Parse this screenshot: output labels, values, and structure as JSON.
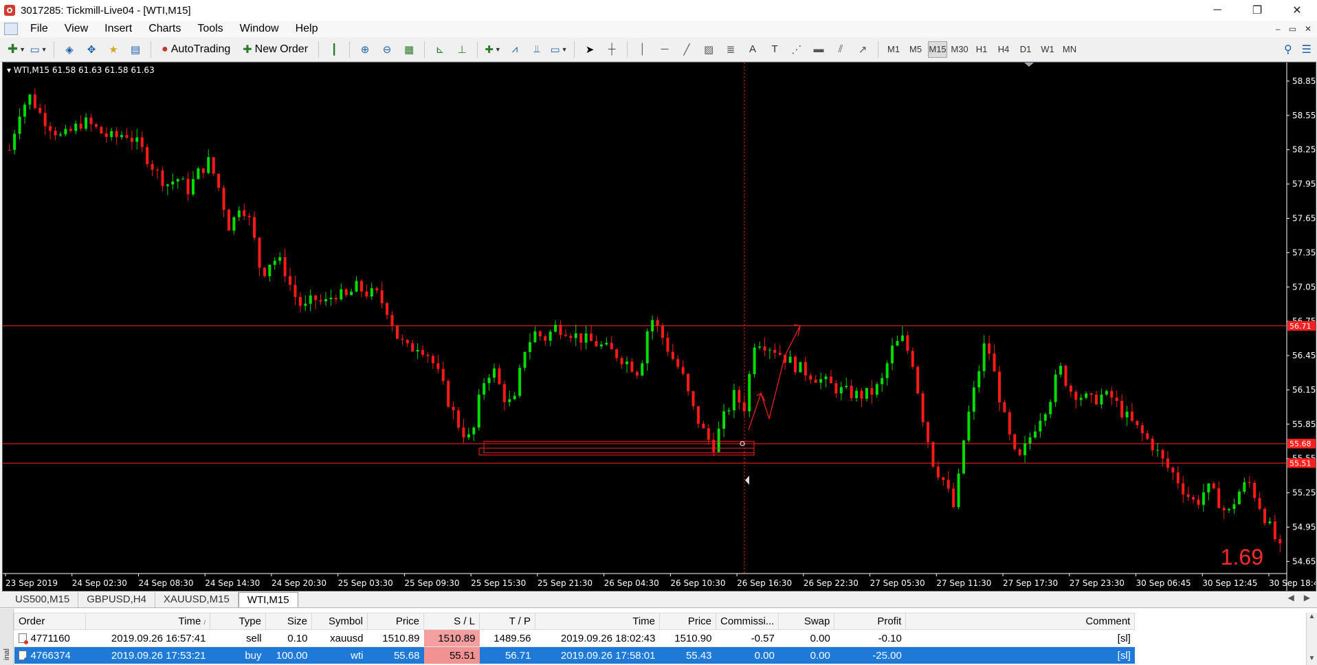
{
  "window": {
    "title": "3017285: Tickmill-Live04 - [WTI,M15]",
    "minimize": "─",
    "maximize": "❐",
    "close": "✕"
  },
  "menu": {
    "items": [
      "File",
      "View",
      "Insert",
      "Charts",
      "Tools",
      "Window",
      "Help"
    ],
    "mdi_min": "–",
    "mdi_restore": "▭",
    "mdi_close": "✕"
  },
  "toolbar": {
    "autotrading_label": "AutoTrading",
    "new_order_label": "New Order",
    "timeframes": [
      "M1",
      "M5",
      "M15",
      "M30",
      "H1",
      "H4",
      "D1",
      "W1",
      "MN"
    ],
    "active_timeframe": "M15"
  },
  "chart": {
    "info": "WTI,M15  61.58 61.63 61.58 61.63",
    "big_number": "1.69"
  },
  "chart_data": {
    "type": "candlestick",
    "symbol": "WTI",
    "timeframe": "M15",
    "y_ticks": [
      58.85,
      58.55,
      58.25,
      57.95,
      57.65,
      57.35,
      57.05,
      56.75,
      56.45,
      56.15,
      55.85,
      55.55,
      55.25,
      54.95,
      54.65
    ],
    "ylim": [
      54.55,
      59.0
    ],
    "x_labels": [
      "23 Sep 2019",
      "24 Sep 02:30",
      "24 Sep 08:30",
      "24 Sep 14:30",
      "24 Sep 20:30",
      "25 Sep 03:30",
      "25 Sep 09:30",
      "25 Sep 15:30",
      "25 Sep 21:30",
      "26 Sep 04:30",
      "26 Sep 10:30",
      "26 Sep 16:30",
      "26 Sep 22:30",
      "27 Sep 05:30",
      "27 Sep 11:30",
      "27 Sep 17:30",
      "27 Sep 23:30",
      "30 Sep 06:45",
      "30 Sep 12:45",
      "30 Sep 18:45"
    ],
    "price_lines": [
      {
        "value": 56.71,
        "label": "56.71"
      },
      {
        "value": 55.68,
        "label": "55.68"
      },
      {
        "value": 55.51,
        "label": "55.51"
      }
    ],
    "close_path": [
      58.25,
      58.6,
      58.72,
      58.55,
      58.45,
      58.35,
      58.42,
      58.5,
      58.45,
      58.38,
      58.35,
      58.4,
      58.32,
      58.2,
      58.05,
      57.95,
      58.0,
      57.9,
      58.05,
      58.15,
      57.9,
      57.55,
      57.8,
      57.6,
      57.15,
      57.3,
      57.25,
      57.0,
      56.85,
      56.95,
      56.9,
      57.0,
      56.95,
      57.05,
      57.0,
      56.98,
      56.85,
      56.6,
      56.5,
      56.55,
      56.45,
      56.25,
      56.0,
      55.8,
      55.7,
      56.2,
      56.35,
      56.1,
      56.0,
      56.5,
      56.65,
      56.6,
      56.7,
      56.68,
      56.62,
      56.58,
      56.55,
      56.5,
      56.45,
      56.38,
      56.3,
      56.8,
      56.65,
      56.45,
      56.3,
      56.0,
      55.8,
      55.65,
      55.9,
      56.1,
      56.0,
      56.6,
      56.55,
      56.5,
      56.42,
      56.35,
      56.3,
      56.25,
      56.2,
      56.15,
      56.12,
      56.1,
      56.12,
      56.2,
      56.5,
      56.6,
      56.4,
      55.9,
      55.5,
      55.35,
      55.1,
      55.8,
      56.2,
      56.6,
      56.2,
      55.8,
      55.5,
      55.7,
      55.9,
      56.05,
      56.35,
      56.15,
      56.1,
      56.05,
      56.1,
      56.08,
      55.95,
      55.85,
      55.75,
      55.65,
      55.5,
      55.4,
      55.25,
      55.15,
      55.3,
      55.2,
      55.05,
      55.25,
      55.35,
      55.15,
      54.95,
      54.75
    ]
  },
  "tabs": [
    "US500,M15",
    "GBPUSD,H4",
    "XAUUSD,M15",
    "WTI,M15"
  ],
  "active_tab": "WTI,M15",
  "terminal": {
    "side_label": "inal",
    "columns": [
      "Order",
      "Time",
      "Type",
      "Size",
      "Symbol",
      "Price",
      "S / L",
      "T / P",
      "Time",
      "Price",
      "Commissi...",
      "Swap",
      "Profit",
      "Comment"
    ],
    "rows": [
      {
        "order": "4771160",
        "time": "2019.09.26 16:57:41",
        "type": "sell",
        "size": "0.10",
        "symbol": "xauusd",
        "price": "1510.89",
        "sl": "1510.89",
        "tp": "1489.56",
        "close_time": "2019.09.26 18:02:43",
        "close_price": "1510.90",
        "commission": "-0.57",
        "swap": "0.00",
        "profit": "-0.10",
        "comment": "[sl]"
      },
      {
        "order": "4766374",
        "time": "2019.09.26 17:53:21",
        "type": "buy",
        "size": "100.00",
        "symbol": "wti",
        "price": "55.68",
        "sl": "55.51",
        "tp": "56.71",
        "close_time": "2019.09.26 17:58:01",
        "close_price": "55.43",
        "commission": "0.00",
        "swap": "0.00",
        "profit": "-25.00",
        "comment": "[sl]"
      }
    ]
  }
}
